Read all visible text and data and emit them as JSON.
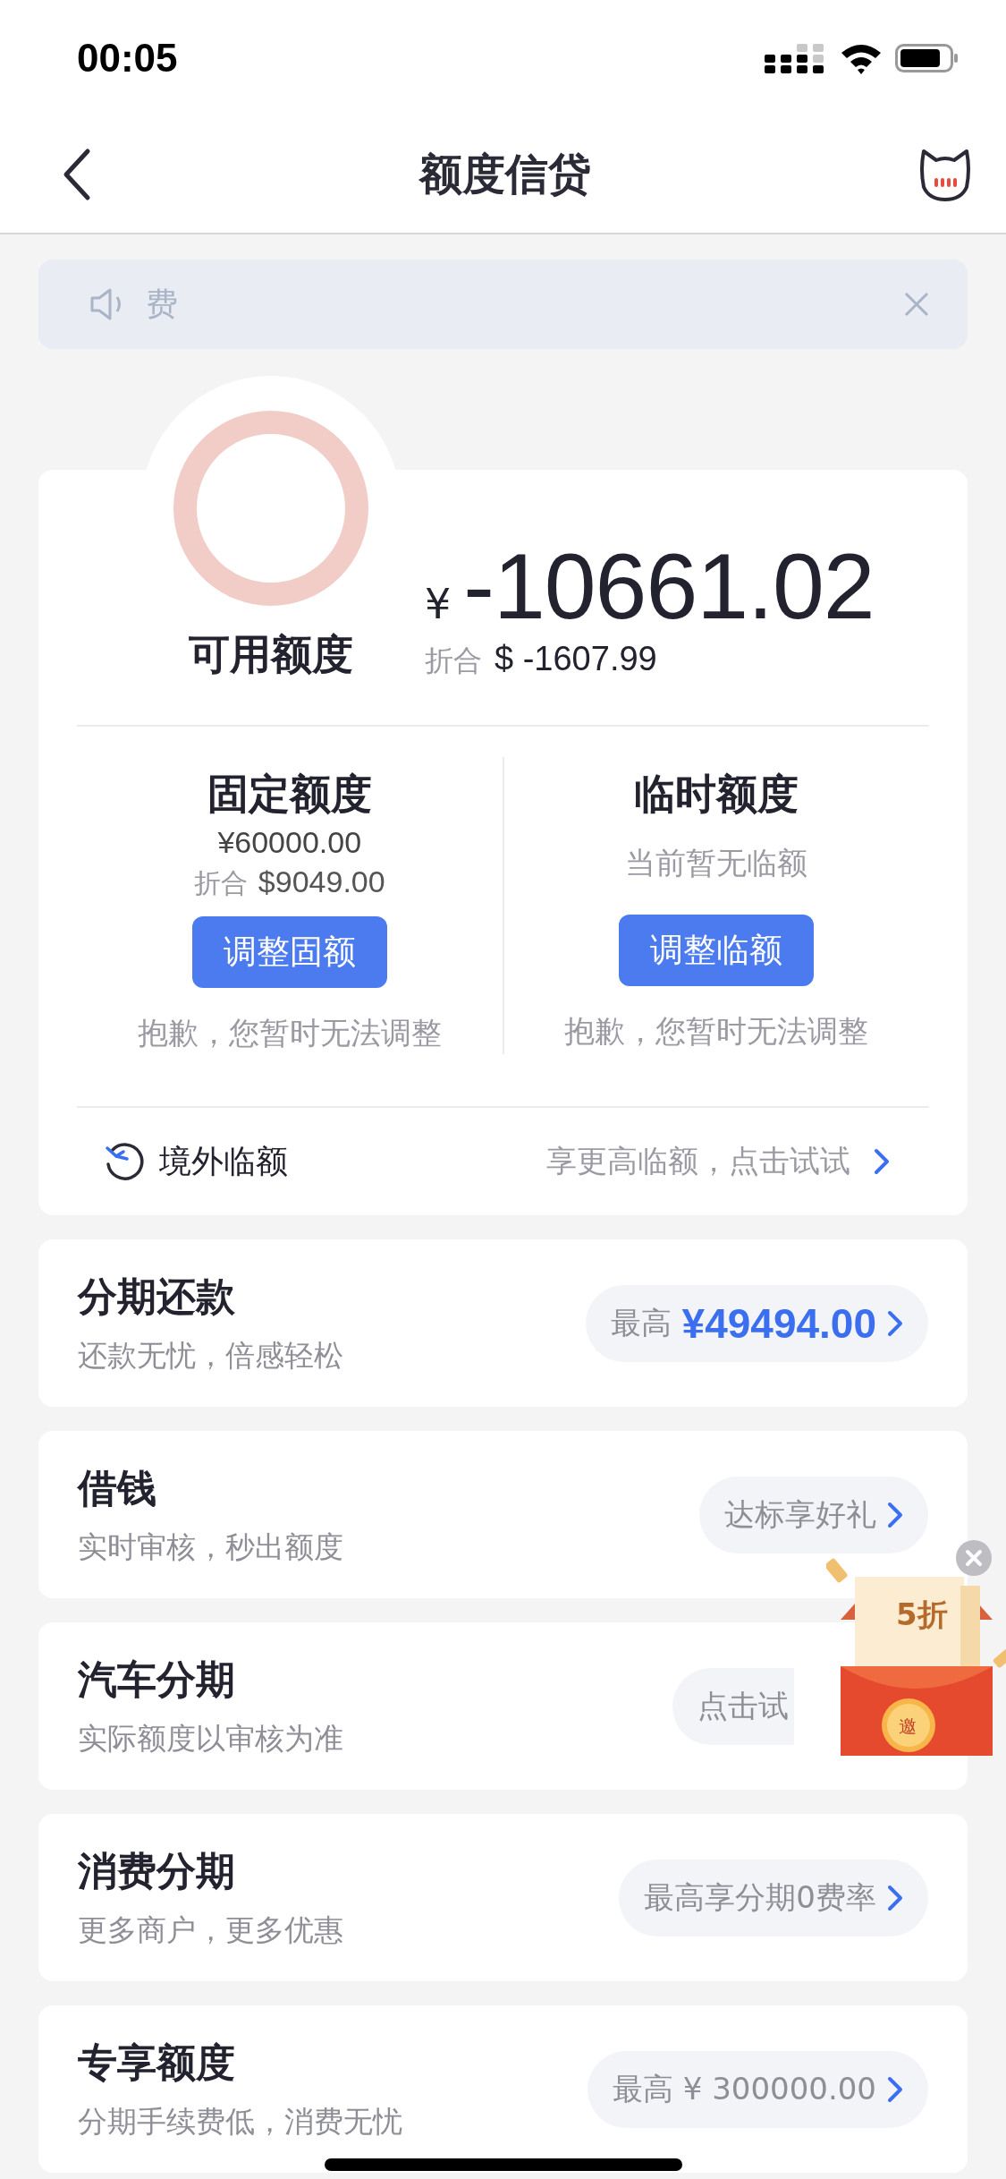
{
  "status_bar": {
    "time": "00:05"
  },
  "nav": {
    "title": "额度信贷"
  },
  "notice": {
    "text": "费"
  },
  "credit": {
    "label": "可用额度",
    "currency": "¥",
    "amount": "-10661.02",
    "converted_label": "折合",
    "converted": "$ -1607.99",
    "columns": [
      {
        "title": "固定额度",
        "amount": "¥60000.00",
        "converted_label": "折合",
        "converted": "$9049.00",
        "button": "调整固额",
        "note": "抱歉，您暂时无法调整"
      },
      {
        "title": "临时额度",
        "status": "当前暂无临额",
        "button": "调整临额",
        "note": "抱歉，您暂时无法调整"
      }
    ],
    "overseas": {
      "label": "境外临额",
      "hint": "享更高临额，点击试试"
    }
  },
  "products": [
    {
      "title": "分期还款",
      "subtitle": "还款无忧，倍感轻松",
      "badge_prefix": "最高",
      "badge": "¥49494.00",
      "highlight": true,
      "covered": false
    },
    {
      "title": "借钱",
      "subtitle": "实时审核，秒出额度",
      "badge": "达标享好礼",
      "highlight": false,
      "covered": false
    },
    {
      "title": "汽车分期",
      "subtitle": "实际额度以审核为准",
      "badge": "点击试",
      "highlight": false,
      "covered": true
    },
    {
      "title": "消费分期",
      "subtitle": "更多商户，更多优惠",
      "badge": "最高享分期0费率",
      "highlight": false,
      "covered": false
    },
    {
      "title": "专享额度",
      "subtitle": "分期手续费低，消费无忧",
      "badge": "最高 ¥ 300000.00",
      "highlight": false,
      "covered": false
    }
  ],
  "promo": {
    "label": "5折",
    "seal": "邀"
  }
}
